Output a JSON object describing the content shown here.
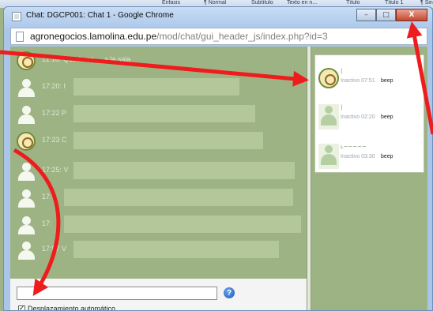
{
  "background_app": {
    "ribbon_styles": [
      "Énfasis",
      "¶ Normal",
      "Subtítulo",
      "Texto en n...",
      "Título",
      "Título 1",
      "¶ Sin"
    ]
  },
  "window": {
    "title": "Chat: DGCP001: Chat 1 - Google Chrome",
    "controls": {
      "minimize": "–",
      "maximize": "□",
      "close": "X"
    }
  },
  "address": {
    "host": "agronegocios.lamolina.edu.pe",
    "path": "/mod/chat/gui_header_js/index.php?id=3"
  },
  "messages": [
    {
      "avatar": "seal",
      "text": "11:18: Quedo en ... a la sala"
    },
    {
      "avatar": "person",
      "text": "17:20: I"
    },
    {
      "avatar": "person",
      "text": "17:22 P"
    },
    {
      "avatar": "seal",
      "text": "17:23 C"
    },
    {
      "avatar": "person",
      "text": "17:25: V"
    },
    {
      "avatar": "person",
      "text": "17:"
    },
    {
      "avatar": "person",
      "text": "17:"
    },
    {
      "avatar": "person",
      "text": "17:57 V"
    }
  ],
  "input": {
    "value": "",
    "help_label": "?",
    "autoscroll_label": "Desplazamiento automático"
  },
  "users": [
    {
      "avatar": "seal",
      "name": "|",
      "status": "Inactivo 07:51",
      "action": "beep"
    },
    {
      "avatar": "person",
      "name": "|",
      "status": "Inactivo 02:20",
      "action": "beep"
    },
    {
      "avatar": "person",
      "name": "ʟ~~~~~",
      "status": "Inactivo 03:30",
      "action": "beep"
    }
  ],
  "annotation_color": "#ee1c1c"
}
